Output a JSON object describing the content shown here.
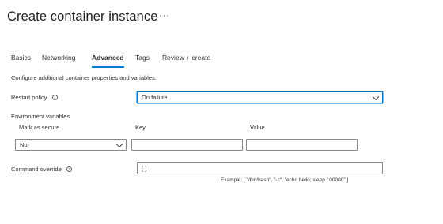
{
  "page": {
    "title": "Create container instance",
    "more_glyph": "···"
  },
  "tabs": [
    {
      "label": "Basics",
      "active": false
    },
    {
      "label": "Networking",
      "active": false
    },
    {
      "label": "Advanced",
      "active": true
    },
    {
      "label": "Tags",
      "active": false
    },
    {
      "label": "Review + create",
      "active": false
    }
  ],
  "description": "Configure additional container properties and variables.",
  "restart_policy": {
    "label": "Restart policy",
    "info_glyph": "i",
    "value": "On failure"
  },
  "env_vars": {
    "label": "Environment variables",
    "col_secure": "Mark as secure",
    "col_key": "Key",
    "col_value": "Value",
    "row": {
      "secure_value": "No",
      "key": "",
      "value": ""
    }
  },
  "command_override": {
    "label": "Command override",
    "info_glyph": "i",
    "value": "[ ]",
    "example": "Example: [ \"/bin/bash\", \"-c\", \"echo hello; sleep 100000\" ]"
  }
}
